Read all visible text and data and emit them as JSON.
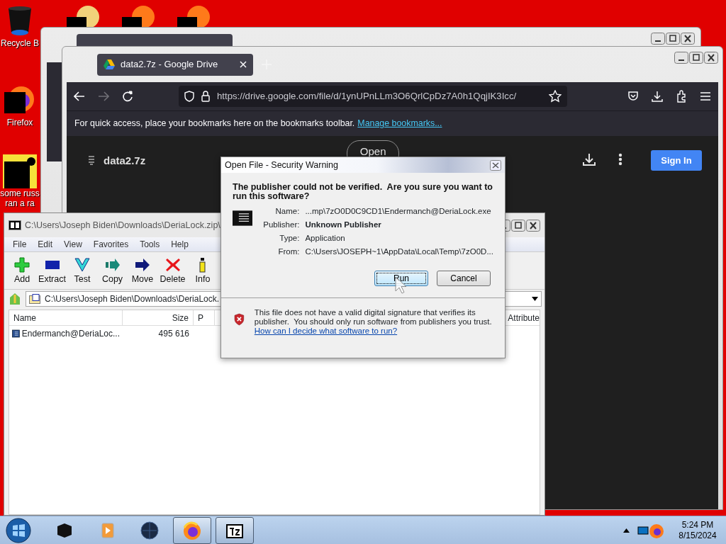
{
  "desktop": {
    "icons": [
      {
        "kind": "bin",
        "label": [
          "Recycle B"
        ]
      },
      {
        "kind": "firefox",
        "label": [
          "Firefox"
        ]
      },
      {
        "kind": "doc",
        "label": [
          "some russ",
          "ran a ra"
        ]
      }
    ]
  },
  "browser": {
    "tabs": [
      {
        "label": "data2.7z - Google Drive",
        "selected": true
      }
    ],
    "url": "https://drive.google.com/file/d/1ynUPnLLm3O6QrlCpDz7A0h1QqjIK3Icc/",
    "bookmarks_hint": "For quick access, place your bookmarks here on the bookmarks toolbar.",
    "bookmarks_link": "Manage bookmarks...",
    "file_name": "data2.7z",
    "open_button": "Open",
    "sign_in_button": "Sign In"
  },
  "archive_window": {
    "title": "C:\\Users\\Joseph Biden\\Downloads\\DeriaLock.zip\\",
    "menu": [
      "File",
      "Edit",
      "View",
      "Favorites",
      "Tools",
      "Help"
    ],
    "toolbar": [
      {
        "kind": "add",
        "label": "Add"
      },
      {
        "kind": "extract",
        "label": "Extract"
      },
      {
        "kind": "test",
        "label": "Test"
      },
      {
        "kind": "copy",
        "label": "Copy"
      },
      {
        "kind": "move",
        "label": "Move"
      },
      {
        "kind": "delete",
        "label": "Delete"
      },
      {
        "kind": "info",
        "label": "Info"
      }
    ],
    "path": "C:\\Users\\Joseph Biden\\Downloads\\DeriaLock.",
    "columns": [
      "Name",
      "Size",
      "P",
      "Attribute"
    ],
    "rows": [
      {
        "name": "Endermanch@DeriaLoc...",
        "size": "495 616"
      }
    ]
  },
  "dialog": {
    "title": "Open File - Security Warning",
    "heading": "The publisher could not be verified.  Are you sure you want to run this software?",
    "fields": [
      {
        "label": "Name:",
        "value": "...mp\\7zO0D0C9CD1\\Endermanch@DeriaLock.exe",
        "bold": false
      },
      {
        "label": "Publisher:",
        "value": "Unknown Publisher",
        "bold": true
      },
      {
        "label": "Type:",
        "value": "Application",
        "bold": false
      },
      {
        "label": "From:",
        "value": "C:\\Users\\JOSEPH~1\\AppData\\Local\\Temp\\7zO0D...",
        "bold": false
      }
    ],
    "buttons": [
      {
        "label": "Run",
        "selected": true
      },
      {
        "label": "Cancel",
        "selected": false
      }
    ],
    "warning": "This file does not have a valid digital signature that verifies its publisher.  You should only run software from publishers you trust.",
    "help_link": "How can I decide what software to run?"
  },
  "taskbar": {
    "items": [
      {
        "kind": "box",
        "running": false
      },
      {
        "kind": "media",
        "running": false
      },
      {
        "kind": "globe",
        "running": false
      },
      {
        "kind": "firefox",
        "running": true
      },
      {
        "kind": "sevenzip",
        "running": true
      }
    ],
    "time": "5:24 PM",
    "date": "8/15/2024"
  }
}
